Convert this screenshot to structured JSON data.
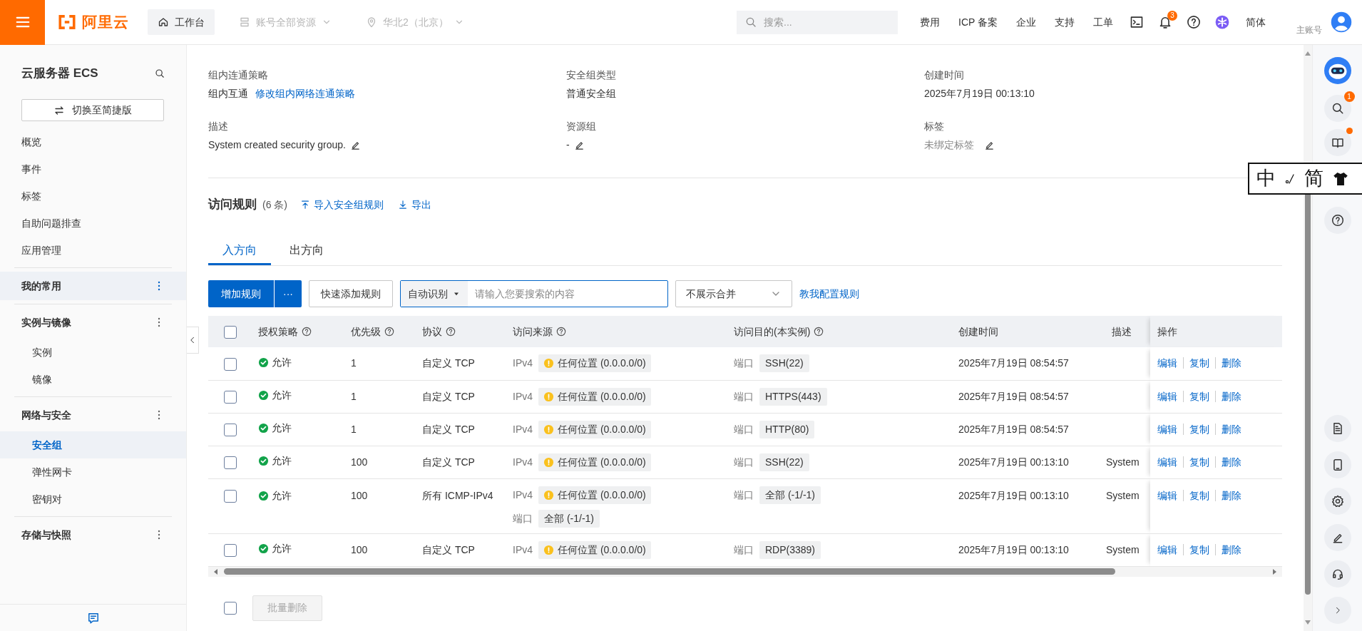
{
  "header": {
    "logo": "阿里云",
    "nav": [
      {
        "label": "工作台",
        "kind": "workbench",
        "disabled": false
      },
      {
        "label": "账号全部资源",
        "kind": "resource",
        "disabled": true
      },
      {
        "label": "华北2（北京）",
        "kind": "region",
        "disabled": true
      }
    ],
    "search": {
      "placeholder": "搜索..."
    },
    "links": [
      "费用",
      "ICP 备案",
      "企业",
      "支持",
      "工单"
    ],
    "tools": [
      {
        "kind": "terminal"
      },
      {
        "kind": "bell",
        "badge": "3"
      },
      {
        "kind": "help"
      },
      {
        "kind": "assistant"
      }
    ],
    "language": "简体",
    "account": {
      "role": "主账号"
    }
  },
  "sidebar": {
    "title": "云服务器 ECS",
    "switch_button": "切换至简捷版",
    "items": [
      {
        "label": "概览",
        "selected": false
      },
      {
        "label": "事件",
        "selected": false
      },
      {
        "label": "标签",
        "selected": false
      },
      {
        "label": "自助问题排查",
        "selected": false
      },
      {
        "label": "应用管理",
        "selected": false
      }
    ],
    "groups": [
      {
        "label": "我的常用",
        "highlighted": true
      },
      {
        "label": "实例与镜像",
        "highlighted": false,
        "items": [
          {
            "label": "实例",
            "selected": false
          },
          {
            "label": "镜像",
            "selected": false
          }
        ]
      },
      {
        "label": "网络与安全",
        "highlighted": false,
        "items": [
          {
            "label": "安全组",
            "selected": true
          },
          {
            "label": "弹性网卡",
            "selected": false
          },
          {
            "label": "密钥对",
            "selected": false
          }
        ]
      },
      {
        "label": "存储与快照",
        "highlighted": false
      }
    ]
  },
  "details": [
    {
      "label": "组内连通策略",
      "value": "组内互通",
      "link": "修改组内网络连通策略"
    },
    {
      "label": "安全组类型",
      "value": "普通安全组"
    },
    {
      "label": "创建时间",
      "value": "2025年7月19日 00:13:10"
    },
    {
      "label": "描述",
      "value": "System created security group.",
      "editable": true
    },
    {
      "label": "资源组",
      "value": "-",
      "editable": true
    },
    {
      "label": "标签",
      "value": "未绑定标签",
      "editable": true,
      "muted": true
    }
  ],
  "rules": {
    "title": "访问规则",
    "count": "(6 条)",
    "actions": [
      {
        "label": "导入安全组规则",
        "kind": "import"
      },
      {
        "label": "导出",
        "kind": "export"
      }
    ],
    "tabs": [
      {
        "label": "入方向",
        "selected": true
      },
      {
        "label": "出方向",
        "selected": false
      }
    ],
    "toolbar": {
      "add": "增加规则",
      "more": "···",
      "quick_add": "快速添加规则",
      "filter_type": "自动识别",
      "search_placeholder": "请输入您要搜索的内容",
      "merge_select": "不展示合并",
      "help_link": "教我配置规则"
    },
    "table": {
      "all_selected": false,
      "columns": [
        {
          "label": "授权策略",
          "help": true
        },
        {
          "label": "优先级",
          "help": true
        },
        {
          "label": "协议",
          "help": true
        },
        {
          "label": "访问来源",
          "help": true
        },
        {
          "label": "访问目的(本实例)",
          "help": true
        },
        {
          "label": "创建时间"
        },
        {
          "label": "描述"
        },
        {
          "label": "操作"
        }
      ],
      "rows": [
        {
          "selected": false,
          "policy": "允许",
          "priority": "1",
          "protocol": "自定义 TCP",
          "source_ip": "IPv4",
          "source": "任何位置 (0.0.0.0/0)",
          "dest_label": "端口",
          "dest": "SSH(22)",
          "created": "2025年7月19日 08:54:57",
          "actions": [
            "编辑",
            "复制",
            "删除"
          ]
        },
        {
          "selected": false,
          "policy": "允许",
          "priority": "1",
          "protocol": "自定义 TCP",
          "source_ip": "IPv4",
          "source": "任何位置 (0.0.0.0/0)",
          "dest_label": "端口",
          "dest": "HTTPS(443)",
          "created": "2025年7月19日 08:54:57",
          "actions": [
            "编辑",
            "复制",
            "删除"
          ]
        },
        {
          "selected": false,
          "policy": "允许",
          "priority": "1",
          "protocol": "自定义 TCP",
          "source_ip": "IPv4",
          "source": "任何位置 (0.0.0.0/0)",
          "dest_label": "端口",
          "dest": "HTTP(80)",
          "created": "2025年7月19日 08:54:57",
          "actions": [
            "编辑",
            "复制",
            "删除"
          ]
        },
        {
          "selected": false,
          "policy": "允许",
          "priority": "100",
          "protocol": "自定义 TCP",
          "source_ip": "IPv4",
          "source": "任何位置 (0.0.0.0/0)",
          "dest_label": "端口",
          "dest": "SSH(22)",
          "created": "2025年7月19日 00:13:10",
          "description": "System",
          "actions": [
            "编辑",
            "复制",
            "删除"
          ]
        },
        {
          "selected": false,
          "policy": "允许",
          "priority": "100",
          "protocol": "所有 ICMP-IPv4",
          "source_ip": "IPv4",
          "source": "任何位置 (0.0.0.0/0)",
          "source_port_label": "端口",
          "source_port": "全部 (-1/-1)",
          "dest_label": "端口",
          "dest": "全部 (-1/-1)",
          "created": "2025年7月19日 00:13:10",
          "description": "System",
          "actions": [
            "编辑",
            "复制",
            "删除"
          ]
        },
        {
          "selected": false,
          "policy": "允许",
          "priority": "100",
          "protocol": "自定义 TCP",
          "source_ip": "IPv4",
          "source": "任何位置 (0.0.0.0/0)",
          "dest_label": "端口",
          "dest": "RDP(3389)",
          "created": "2025年7月19日 00:13:10",
          "description": "System",
          "actions": [
            "编辑",
            "复制",
            "删除"
          ]
        }
      ]
    },
    "batch": {
      "selected": false,
      "delete_button": "批量删除",
      "disabled": true
    }
  },
  "rail": {
    "top": [
      {
        "kind": "assistant"
      },
      {
        "kind": "search",
        "badge": "1"
      },
      {
        "kind": "book",
        "dot": true
      },
      {
        "kind": "help"
      }
    ],
    "bottom": [
      {
        "kind": "doc"
      },
      {
        "kind": "app"
      },
      {
        "kind": "settings"
      },
      {
        "kind": "edit"
      },
      {
        "kind": "support"
      },
      {
        "kind": "expand"
      }
    ]
  },
  "ime_bar": {
    "mode": "中",
    "script": "简"
  }
}
